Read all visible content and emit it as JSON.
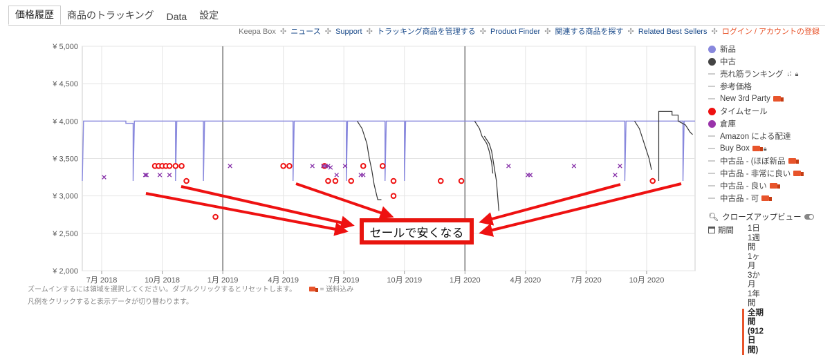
{
  "tabs": [
    "価格履歴",
    "商品のトラッキング",
    "Data",
    "設定"
  ],
  "toplinks": {
    "keepa_box": "Keepa Box",
    "news": "ニュース",
    "support": "Support",
    "manage": "トラッキング商品を管理する",
    "finder": "Product Finder",
    "related": "関連する商品を探す",
    "bestsellers": "Related Best Sellers",
    "login": "ログイン / アカウントの登録"
  },
  "legend": [
    {
      "label": "新品",
      "marker": "dot",
      "color": "#8888dd"
    },
    {
      "label": "中古",
      "marker": "dot",
      "color": "#444444"
    },
    {
      "label": "売れ筋ランキング",
      "marker": "dash",
      "color": "#cccccc",
      "suffix": "sort-icon lock-icon"
    },
    {
      "label": "参考価格",
      "marker": "dash",
      "color": "#cccccc"
    },
    {
      "label": "New 3rd Party",
      "marker": "dash",
      "color": "#cccccc",
      "suffix": "truck-icon"
    },
    {
      "label": "タイムセール",
      "marker": "dot",
      "color": "#ee1111"
    },
    {
      "label": "倉庫",
      "marker": "dot",
      "color": "#9933aa"
    },
    {
      "label": "Amazon による配達",
      "marker": "dash",
      "color": "#cccccc"
    },
    {
      "label": "Buy Box",
      "marker": "dash",
      "color": "#cccccc",
      "suffix": "truck-icon lock-icon"
    },
    {
      "label": "中古品 - (ほぼ新品",
      "marker": "dash",
      "color": "#cccccc",
      "suffix": "truck-icon"
    },
    {
      "label": "中古品 - 非常に良い",
      "marker": "dash",
      "color": "#cccccc",
      "suffix": "truck-icon"
    },
    {
      "label": "中古品 - 良い",
      "marker": "dash",
      "color": "#cccccc",
      "suffix": "truck-icon"
    },
    {
      "label": "中古品 - 可",
      "marker": "dash",
      "color": "#cccccc",
      "suffix": "truck-icon"
    }
  ],
  "close_up": "クローズアップビュー",
  "period": {
    "label": "期間",
    "options": [
      "1日",
      "1週間",
      "1ヶ月",
      "3か月",
      "1年間",
      "全期間 (912 日間)"
    ],
    "selected": 5
  },
  "notes": {
    "zoom": "ズームインするには領域を選択してください。ダブルクリックするとリセットします。",
    "shipping": "= 送料込み",
    "legend": "凡例をクリックすると表示データが切り替わります。"
  },
  "annotation": "セールで安くなる",
  "colors": {
    "new": "#8888dd",
    "used": "#333333",
    "deal": "#ee1111",
    "warehouse": "#8833aa",
    "arrow": "#ee1111"
  },
  "chart_data": {
    "type": "line",
    "y_tick_labels": [
      "¥ 2,000",
      "¥ 2,500",
      "¥ 3,000",
      "¥ 3,500",
      "¥ 4,000",
      "¥ 4,500",
      "¥ 5,000"
    ],
    "y_ticks": [
      2000,
      2500,
      3000,
      3500,
      4000,
      4500,
      5000
    ],
    "ylim": [
      2000,
      5000
    ],
    "x_tick_labels": [
      "7月 2018",
      "10月 2018",
      "1月 2019",
      "4月 2019",
      "7月 2019",
      "10月 2019",
      "1月 2020",
      "4月 2020",
      "7月 2020",
      "10月 2020"
    ],
    "x_ticks": [
      2018.5,
      2018.75,
      2019.0,
      2019.25,
      2019.5,
      2019.75,
      2020.0,
      2020.25,
      2020.5,
      2020.75
    ],
    "xlim": [
      2018.42,
      2020.95
    ],
    "year_lines": [
      2019.0,
      2020.0
    ],
    "grid": true,
    "legend_position": "right",
    "series": [
      {
        "name": "新品",
        "kind": "step",
        "points": [
          [
            2018.42,
            3200
          ],
          [
            2018.425,
            4000
          ],
          [
            2018.6,
            4000
          ],
          [
            2018.6,
            3970
          ],
          [
            2018.63,
            3970
          ],
          [
            2018.63,
            3200
          ],
          [
            2018.635,
            4000
          ],
          [
            2018.805,
            4000
          ],
          [
            2018.805,
            3200
          ],
          [
            2018.81,
            4000
          ],
          [
            2018.92,
            4000
          ],
          [
            2018.92,
            3200
          ],
          [
            2018.925,
            4000
          ],
          [
            2019.29,
            4000
          ],
          [
            2019.29,
            3200
          ],
          [
            2019.295,
            4000
          ],
          [
            2019.51,
            4000
          ],
          [
            2019.51,
            3200
          ],
          [
            2019.515,
            4000
          ],
          [
            2019.67,
            4000
          ],
          [
            2019.67,
            3200
          ],
          [
            2019.675,
            4000
          ],
          [
            2019.75,
            4000
          ],
          [
            2019.75,
            3200
          ],
          [
            2019.755,
            4000
          ],
          [
            2020.66,
            4000
          ],
          [
            2020.66,
            3200
          ],
          [
            2020.665,
            4000
          ],
          [
            2020.9,
            4000
          ],
          [
            2020.9,
            3200
          ],
          [
            2020.905,
            4000
          ],
          [
            2020.95,
            4000
          ]
        ]
      },
      {
        "name": "中古",
        "kind": "line",
        "segments": [
          [
            [
              2019.555,
              4000
            ],
            [
              2019.575,
              3900
            ],
            [
              2019.585,
              3800
            ],
            [
              2019.595,
              3700
            ],
            [
              2019.6,
              3600
            ],
            [
              2019.605,
              3500
            ],
            [
              2019.615,
              3350
            ],
            [
              2019.625,
              3150
            ],
            [
              2019.64,
              2950
            ],
            [
              2019.655,
              2950
            ]
          ],
          [
            [
              2020.04,
              4000
            ],
            [
              2020.06,
              3900
            ],
            [
              2020.07,
              3800
            ],
            [
              2020.09,
              3700
            ],
            [
              2020.1,
              3600
            ],
            [
              2020.11,
              3450
            ],
            [
              2020.115,
              3300
            ]
          ],
          [
            [
              2020.08,
              3800
            ],
            [
              2020.1,
              3700
            ],
            [
              2020.11,
              3600
            ],
            [
              2020.13,
              3200
            ],
            [
              2020.14,
              2800
            ]
          ],
          [
            [
              2020.7,
              4000
            ],
            [
              2020.72,
              3900
            ],
            [
              2020.73,
              3800
            ],
            [
              2020.74,
              3700
            ],
            [
              2020.75,
              3600
            ],
            [
              2020.76,
              3500
            ],
            [
              2020.77,
              3350
            ]
          ],
          [
            [
              2020.8,
              3200
            ],
            [
              2020.8,
              4130
            ],
            [
              2020.855,
              4130
            ],
            [
              2020.855,
              4080
            ],
            [
              2020.88,
              4080
            ],
            [
              2020.88,
              4000
            ],
            [
              2020.91,
              3950
            ],
            [
              2020.93,
              3850
            ],
            [
              2020.94,
              3820
            ]
          ]
        ]
      },
      {
        "name": "タイムセール",
        "kind": "circles",
        "points": [
          [
            2018.72,
            3400
          ],
          [
            2018.735,
            3400
          ],
          [
            2018.75,
            3400
          ],
          [
            2018.765,
            3400
          ],
          [
            2018.78,
            3400
          ],
          [
            2018.805,
            3400
          ],
          [
            2018.83,
            3400
          ],
          [
            2018.85,
            3200
          ],
          [
            2018.97,
            2720
          ],
          [
            2019.25,
            3400
          ],
          [
            2019.275,
            3400
          ],
          [
            2019.42,
            3400
          ],
          [
            2019.435,
            3200
          ],
          [
            2019.465,
            3200
          ],
          [
            2019.53,
            3200
          ],
          [
            2019.58,
            3400
          ],
          [
            2019.66,
            3400
          ],
          [
            2019.705,
            3200
          ],
          [
            2019.705,
            3000
          ],
          [
            2019.9,
            3200
          ],
          [
            2019.985,
            3200
          ],
          [
            2020.775,
            3200
          ]
        ]
      },
      {
        "name": "倉庫",
        "kind": "cross",
        "points": [
          [
            2018.51,
            3250
          ],
          [
            2018.68,
            3280
          ],
          [
            2018.685,
            3280
          ],
          [
            2018.74,
            3280
          ],
          [
            2018.78,
            3280
          ],
          [
            2019.03,
            3400
          ],
          [
            2019.37,
            3400
          ],
          [
            2019.415,
            3400
          ],
          [
            2019.425,
            3400
          ],
          [
            2019.435,
            3400
          ],
          [
            2019.445,
            3380
          ],
          [
            2019.47,
            3280
          ],
          [
            2019.505,
            3400
          ],
          [
            2019.57,
            3280
          ],
          [
            2019.58,
            3280
          ],
          [
            2020.18,
            3400
          ],
          [
            2020.26,
            3280
          ],
          [
            2020.27,
            3280
          ],
          [
            2020.45,
            3400
          ],
          [
            2020.62,
            3280
          ],
          [
            2020.64,
            3400
          ]
        ]
      }
    ]
  }
}
